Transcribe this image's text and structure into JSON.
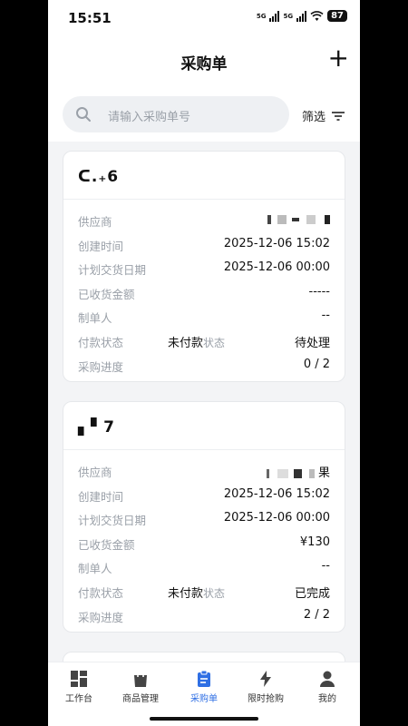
{
  "status": {
    "time": "15:51",
    "net1": "5G",
    "net2": "5G",
    "battery": "87"
  },
  "nav": {
    "title": "采购单",
    "add_label": "+"
  },
  "search": {
    "placeholder": "请输入采购单号",
    "filter_label": "筛选"
  },
  "labels": {
    "supplier": "供应商",
    "created": "创建时间",
    "delivery": "计划交货日期",
    "received": "已收货金额",
    "maker": "制单人",
    "pay_status": "付款状态",
    "progress": "采购进度",
    "status_suffix": "状态"
  },
  "orders": [
    {
      "id": "ᑕ.₊6",
      "created": "2025-12-06 15:02",
      "delivery": "2025-12-06 00:00",
      "received": "-----",
      "maker": "--",
      "pay": "未付款",
      "state": "待处理",
      "progress": "0 / 2"
    },
    {
      "id": "▖▘7",
      "supplier_tail": "果",
      "created": "2025-12-06 15:02",
      "delivery": "2025-12-06 00:00",
      "received": "¥130",
      "maker": "--",
      "pay": "未付款",
      "state": "已完成",
      "progress": "2 / 2"
    }
  ],
  "tabs": [
    {
      "label": "工作台",
      "icon": "dashboard-icon"
    },
    {
      "label": "商品管理",
      "icon": "shopping-bag-icon"
    },
    {
      "label": "采购单",
      "icon": "clipboard-icon"
    },
    {
      "label": "限时抢购",
      "icon": "lightning-icon"
    },
    {
      "label": "我的",
      "icon": "person-icon"
    }
  ],
  "colors": {
    "accent": "#2f6fe4"
  }
}
